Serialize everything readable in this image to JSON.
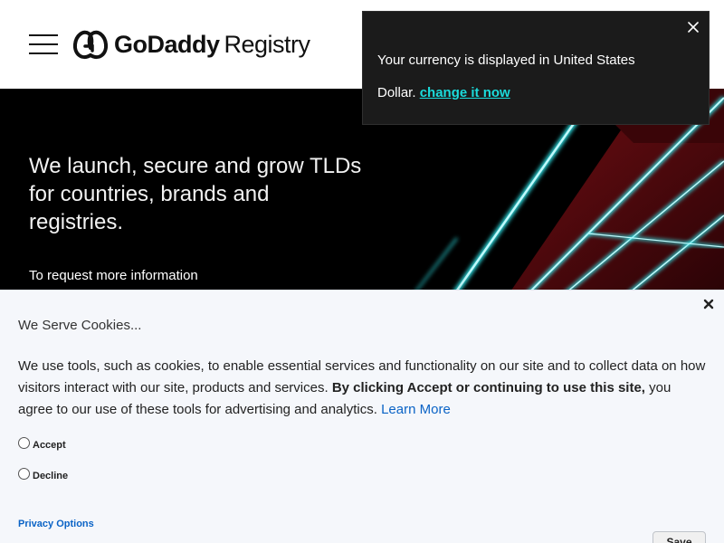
{
  "header": {
    "logo_brand": "GoDaddy",
    "logo_suffix": "Registry"
  },
  "hero": {
    "heading": "We launch, secure and grow TLDs for countries, brands and registries.",
    "subtext": "To request more information"
  },
  "toast": {
    "message": "Your currency is displayed in United States Dollar.",
    "link": "change it now"
  },
  "cookie": {
    "title": "We Serve Cookies...",
    "body_plain": "We use tools, such as cookies, to enable essential services and functionality on our site and to collect data on how visitors interact with our site, products and services.",
    "body_bold": "By clicking Accept or continuing to use this site,",
    "body_tail": "you agree to our use of these tools for advertising and analytics.",
    "learn_more": "Learn More",
    "options": [
      {
        "label": "Accept",
        "selected": false
      },
      {
        "label": "Decline",
        "selected": false
      }
    ],
    "privacy_link": "Privacy Options",
    "save_label": "Save"
  },
  "colors": {
    "link_teal": "#1bdbdb",
    "link_blue": "#0a63c6",
    "toast_bg": "#1b1b1b",
    "banner_bg": "#f5f7fb"
  },
  "icons": [
    "menu-icon",
    "godaddy-logo-icon",
    "close-icon"
  ]
}
